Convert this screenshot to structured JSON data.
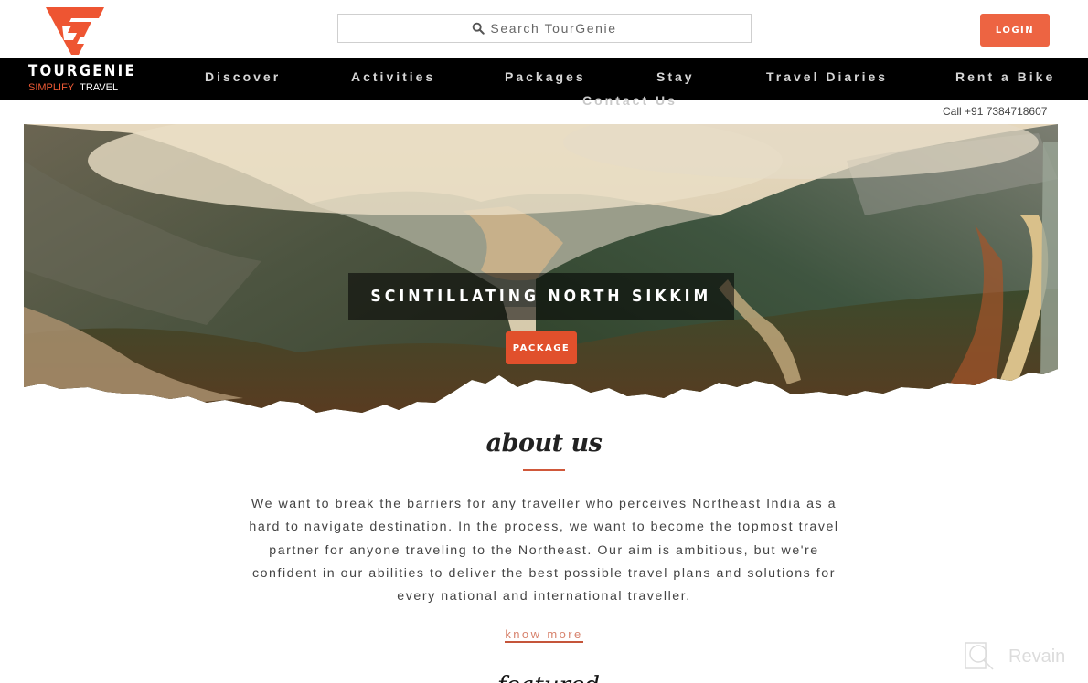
{
  "header": {
    "brand_name": "TOURGENIE",
    "brand_tagline_1": "SIMPLIFY",
    "brand_tagline_2": "TRAVEL",
    "search_placeholder": "Search TourGenie",
    "login_label": "LOGIN",
    "call_text": "Call +91 7384718607"
  },
  "nav": {
    "items": [
      {
        "label": "Discover"
      },
      {
        "label": "Activities"
      },
      {
        "label": "Packages"
      },
      {
        "label": "Stay"
      },
      {
        "label": "Travel Diaries"
      },
      {
        "label": "Rent a Bike"
      },
      {
        "label": "Contact Us"
      }
    ]
  },
  "hero": {
    "title": "SCINTILLATING NORTH SIKKIM",
    "button_label": "PACKAGE"
  },
  "about": {
    "heading": "about us",
    "body": "We want to break the barriers for any traveller who perceives Northeast India as a hard to navigate destination. In the process, we want to become the topmost travel partner for anyone traveling to the Northeast. Our aim is ambitious, but we're confident in our abilities to deliver the best possible travel plans and solutions for every national and international traveller.",
    "link_label": "know more"
  },
  "next_section": {
    "heading_partial": "featured"
  },
  "colors": {
    "accent": "#ed6442",
    "nav_bg": "#000000",
    "button_dark": "#e1502c"
  },
  "watermark": {
    "label": "Revain"
  }
}
